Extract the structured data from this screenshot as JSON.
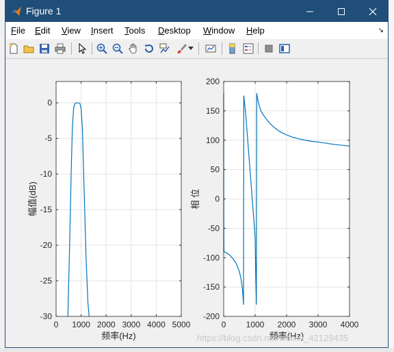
{
  "window": {
    "title": "Figure 1",
    "controls": [
      "minimize-icon",
      "maximize-icon",
      "close-icon"
    ]
  },
  "menu": [
    {
      "label": "File",
      "key": "F",
      "rest": "ile"
    },
    {
      "label": "Edit",
      "key": "E",
      "rest": "dit"
    },
    {
      "label": "View",
      "key": "V",
      "rest": "iew"
    },
    {
      "label": "Insert",
      "key": "I",
      "rest": "nsert"
    },
    {
      "label": "Tools",
      "key": "T",
      "rest": "ools"
    },
    {
      "label": "Desktop",
      "key": "D",
      "rest": "esktop"
    },
    {
      "label": "Window",
      "key": "W",
      "rest": "indow"
    },
    {
      "label": "Help",
      "key": "H",
      "rest": "elp"
    }
  ],
  "toolbar": [
    "new-figure-icon",
    "open-icon",
    "save-icon",
    "print-icon",
    "pointer-icon",
    "zoom-in-icon",
    "zoom-out-icon",
    "pan-icon",
    "rotate-3d-icon",
    "data-cursor-icon",
    "brush-icon",
    "link-plot-icon",
    "colorbar-icon",
    "legend-icon",
    "hide-plot-tools-icon",
    "show-plot-tools-icon"
  ],
  "watermark": "https://blog.csdn.net/weixin_42129435",
  "chart_data": [
    {
      "type": "line",
      "xlabel": "频率(Hz)",
      "ylabel": "幅值(dB)",
      "xlim": [
        0,
        5000
      ],
      "ylim": [
        -30,
        3
      ],
      "xticks": [
        0,
        1000,
        2000,
        3000,
        4000,
        5000
      ],
      "yticks": [
        0,
        -5,
        -10,
        -15,
        -20,
        -25,
        -30
      ],
      "grid": true,
      "series": [
        {
          "color": "#0072bd",
          "x": [
            470,
            540,
            600,
            650,
            700,
            750,
            800,
            850,
            900,
            950,
            1000,
            1050,
            1100,
            1150,
            1200,
            1270,
            1320
          ],
          "y": [
            -30,
            -20,
            -10,
            -3.5,
            -0.8,
            -0.1,
            0,
            0,
            0,
            -0.1,
            -0.8,
            -3.5,
            -10,
            -16,
            -22,
            -28,
            -30
          ]
        }
      ]
    },
    {
      "type": "line",
      "xlabel": "频率(Hz)",
      "ylabel": "相 位",
      "xlim": [
        0,
        4000
      ],
      "ylim": [
        -200,
        200
      ],
      "xticks": [
        0,
        1000,
        2000,
        3000,
        4000
      ],
      "yticks": [
        200,
        150,
        100,
        50,
        0,
        -50,
        -100,
        -150,
        -200
      ],
      "grid": true,
      "series": [
        {
          "color": "#0072bd",
          "x": [
            0,
            3,
            6,
            10,
            100,
            200,
            300,
            400,
            500,
            550,
            600,
            630,
            640,
            650,
            700,
            750,
            800,
            850,
            900,
            950,
            1000,
            1020,
            1040,
            1050,
            1100,
            1150,
            1200,
            1300,
            1400,
            1500,
            1600,
            1800,
            2000,
            2200,
            2500,
            2800,
            3000,
            3500,
            4000
          ],
          "y": [
            180,
            -20,
            -80,
            -90,
            -92,
            -96,
            -102,
            -110,
            -124,
            -136,
            -155,
            -180,
            176,
            170,
            145,
            110,
            75,
            40,
            5,
            -30,
            -65,
            -130,
            -180,
            180,
            165,
            155,
            148,
            140,
            133,
            127,
            122,
            114,
            109,
            105,
            101,
            98,
            97,
            93,
            90
          ]
        }
      ]
    }
  ]
}
